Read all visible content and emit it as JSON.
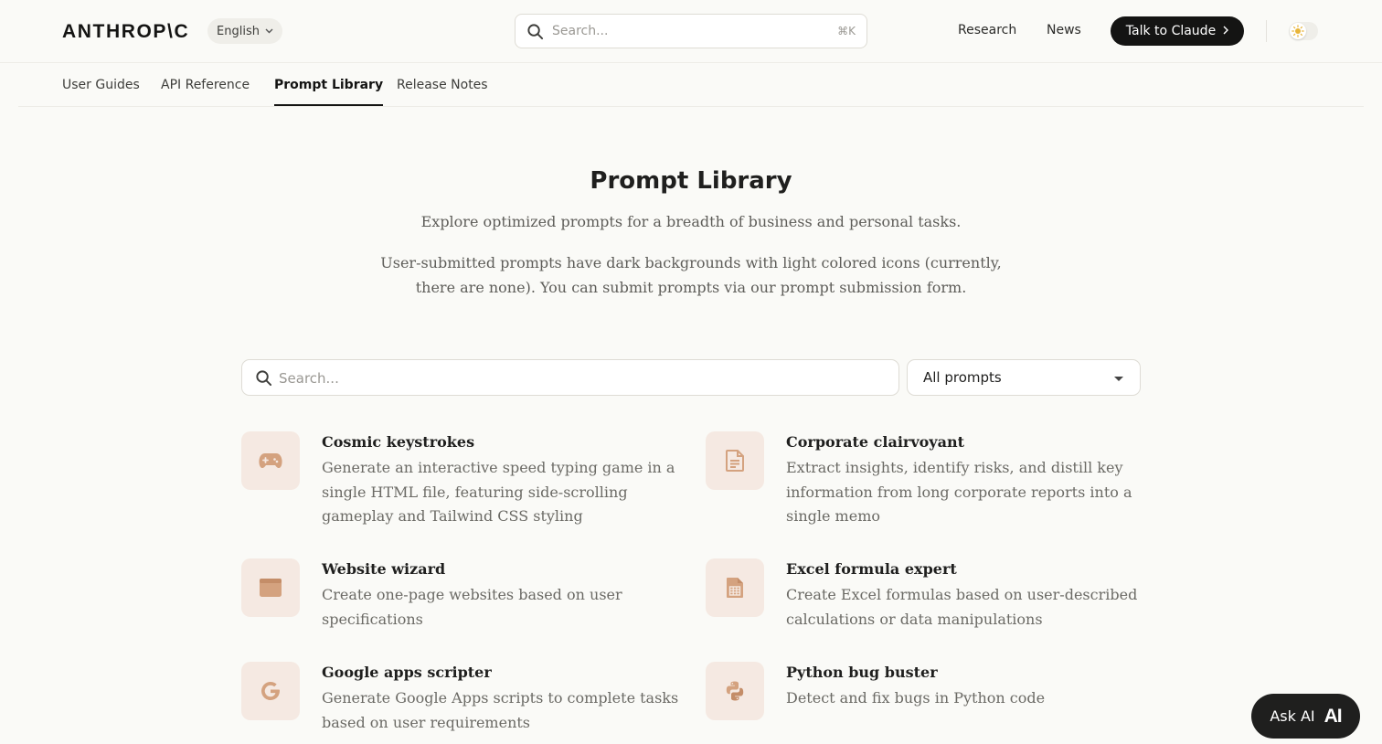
{
  "header": {
    "logo": "ANTHROP\\C",
    "language": "English",
    "search_placeholder": "Search...",
    "search_shortcut": "⌘K",
    "nav": [
      "Research",
      "News"
    ],
    "cta": "Talk to Claude"
  },
  "subnav": {
    "tabs": [
      "User Guides",
      "API Reference",
      "Prompt Library",
      "Release Notes"
    ],
    "active": "Prompt Library"
  },
  "hero": {
    "title": "Prompt Library",
    "subtitle": "Explore optimized prompts for a breadth of business and personal tasks.",
    "note": "User-submitted prompts have dark backgrounds with light colored icons (currently, there are none). You can submit prompts via our prompt submission form."
  },
  "filters": {
    "search_placeholder": "Search...",
    "select_value": "All prompts"
  },
  "cards": [
    {
      "title": "Cosmic keystrokes",
      "desc": "Generate an interactive speed typing game in a single HTML file, featuring side-scrolling gameplay and Tailwind CSS styling",
      "icon": "gamepad-icon"
    },
    {
      "title": "Corporate clairvoyant",
      "desc": "Extract insights, identify risks, and distill key information from long corporate reports into a single memo",
      "icon": "document-icon"
    },
    {
      "title": "Website wizard",
      "desc": "Create one-page websites based on user specifications",
      "icon": "browser-window-icon"
    },
    {
      "title": "Excel formula expert",
      "desc": "Create Excel formulas based on user-described calculations or data manipulations",
      "icon": "spreadsheet-icon"
    },
    {
      "title": "Google apps scripter",
      "desc": "Generate Google Apps scripts to complete tasks based on user requirements",
      "icon": "google-icon"
    },
    {
      "title": "Python bug buster",
      "desc": "Detect and fix bugs in Python code",
      "icon": "python-icon"
    }
  ],
  "ask_ai": {
    "label": "Ask AI",
    "mark": "AI"
  },
  "colors": {
    "background": "#FAFAF7",
    "icon_tile": "#F5E9E2",
    "icon_accent": "#D4A27F",
    "cta_bg": "#141413"
  }
}
